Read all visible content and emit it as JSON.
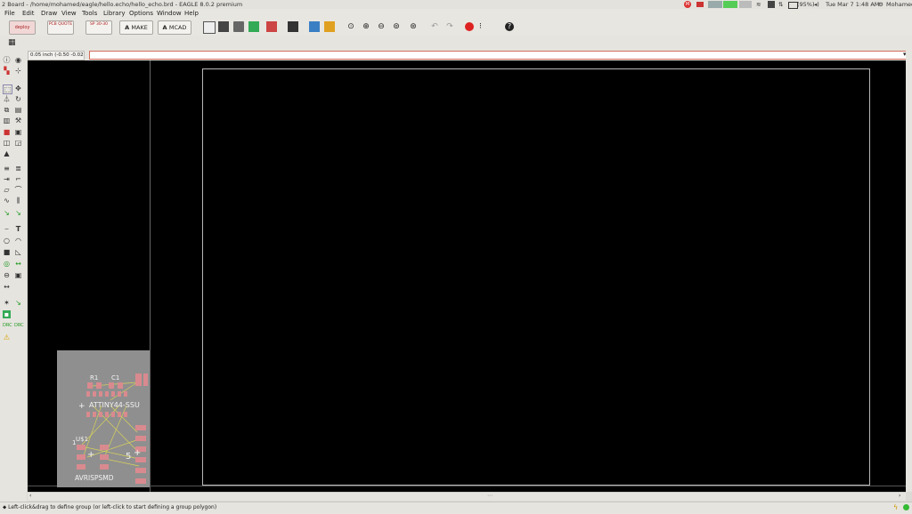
{
  "window": {
    "title": "2 Board - /home/mohamed/eagle/hello.echo/hello_echo.brd - EAGLE 8.0.2 premium"
  },
  "tray": {
    "battery": "(95%)",
    "clock": "Tue Mar 7 1:48 AM",
    "user": "Mohamed",
    "indicator_badge": "M"
  },
  "menu": {
    "items": [
      "File",
      "Edit",
      "Draw",
      "View",
      "Tools",
      "Library",
      "Options",
      "Window",
      "Help"
    ]
  },
  "toolbar": {
    "fusion_btn": "deploy",
    "pcb_quote_btn": "PCB QUOTE",
    "sp_btn": "SP 30-30",
    "make_btn": "MAKE",
    "mcad_btn": "MCAD"
  },
  "command": {
    "grid_coordinate": "0.05 inch (-0.50 -0.02)",
    "input_value": ""
  },
  "board": {
    "labels": {
      "r1": "R1",
      "c1": "C1",
      "ic": "ATTINY44-SSU",
      "u": "U$1",
      "isp": "AVRISPSMD",
      "one": "1",
      "five": "5",
      "plus": "+"
    }
  },
  "status": {
    "message": "Left-click&drag to define group (or left-click to start defining a group polygon)"
  },
  "colors": {
    "canvas": "#000000",
    "pad": "#d98a8f",
    "airwire": "#d8d25a",
    "board_outline": "#b8b8b8"
  }
}
